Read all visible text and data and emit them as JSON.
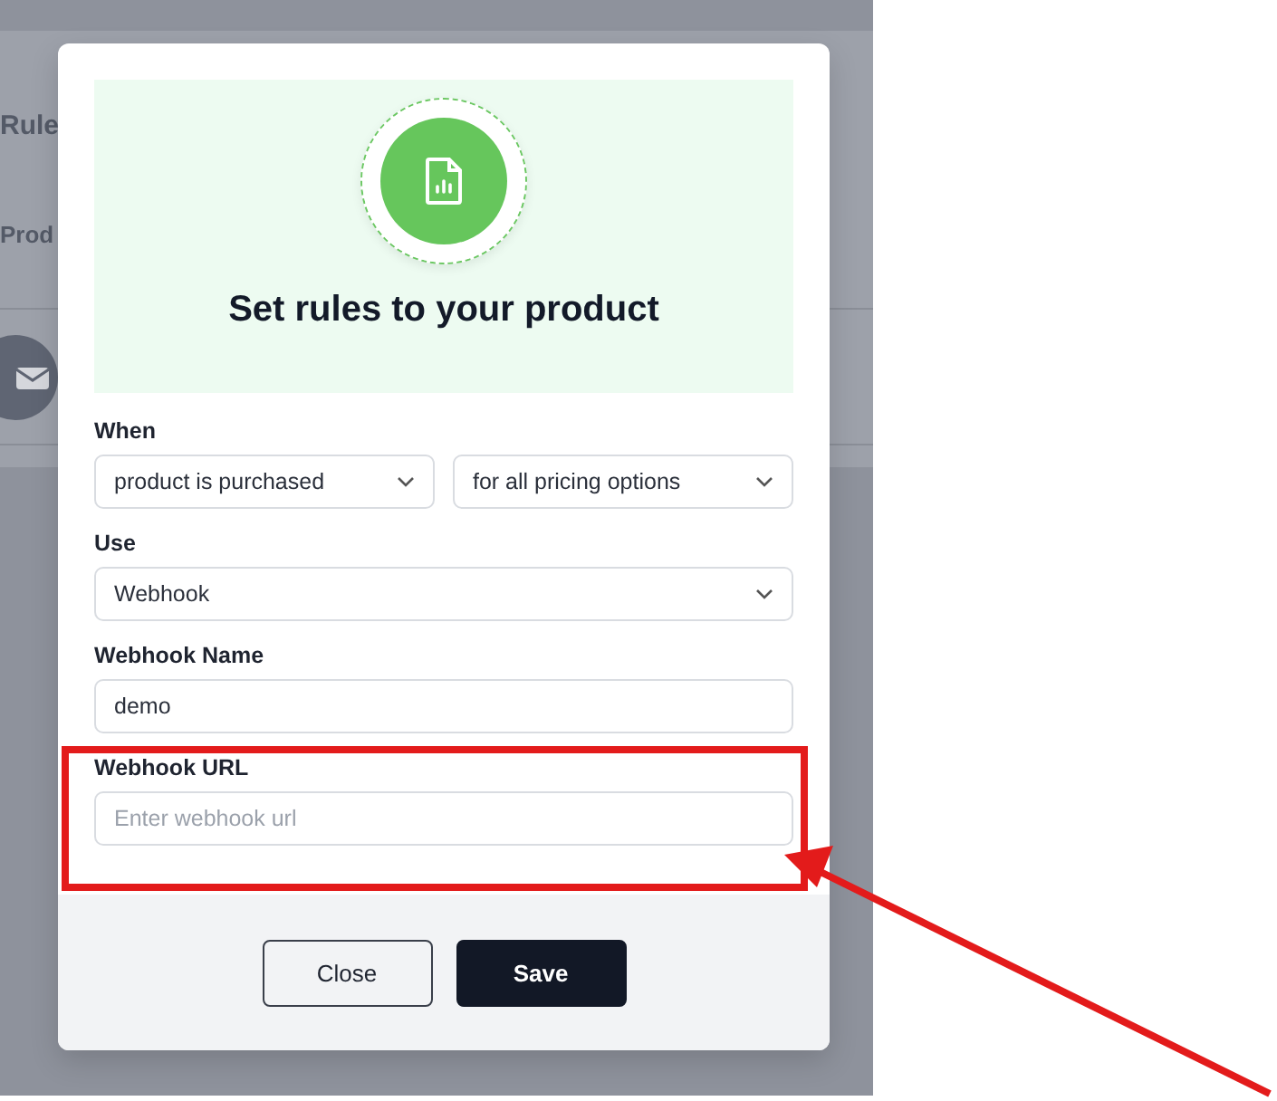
{
  "background_page": {
    "title": "Rule",
    "subtitle": "Prod"
  },
  "modal": {
    "title": "Set rules to your product",
    "fields": [
      {
        "kind": "select-pair",
        "label": "When",
        "values": [
          "product is purchased",
          "for all pricing options"
        ]
      },
      {
        "kind": "select",
        "label": "Use",
        "value": "Webhook"
      },
      {
        "kind": "text",
        "label": "Webhook Name",
        "value": "demo"
      },
      {
        "kind": "text",
        "label": "Webhook URL",
        "placeholder": "Enter webhook url"
      }
    ],
    "buttons": [
      {
        "kind": "secondary",
        "label": "Close"
      },
      {
        "kind": "primary",
        "label": "Save"
      }
    ]
  }
}
